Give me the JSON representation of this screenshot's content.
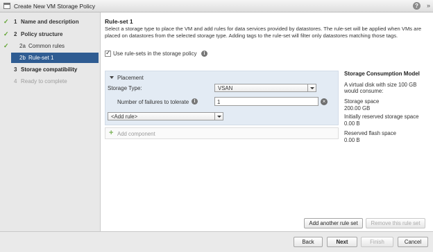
{
  "window": {
    "title": "Create New VM Storage Policy",
    "help_glyph": "?",
    "expand_glyph": "»"
  },
  "sidebar": {
    "steps": [
      {
        "num": "1",
        "label": "Name and description",
        "state": "done"
      },
      {
        "num": "2",
        "label": "Policy structure",
        "state": "done"
      },
      {
        "num": "2a",
        "label": "Common rules",
        "state": "done"
      },
      {
        "num": "2b",
        "label": "Rule-set 1",
        "state": "active"
      },
      {
        "num": "3",
        "label": "Storage compatibility",
        "state": "pending"
      },
      {
        "num": "4",
        "label": "Ready to complete",
        "state": "disabled"
      }
    ]
  },
  "main": {
    "heading": "Rule-set 1",
    "description": "Select a storage type to place the VM and add rules for data services provided by datastores. The rule-set will be applied when VMs are placed on datastores from the selected storage type. Adding tags to the rule-set will filter only datastores matching those tags.",
    "use_rulesets_label": "Use rule-sets in the storage policy",
    "use_rulesets_checked": true,
    "placement": {
      "section_label": "Placement",
      "storage_type_label": "Storage Type:",
      "storage_type_value": "VSAN",
      "ftt_label": "Number of failures to tolerate",
      "ftt_value": "1",
      "add_rule_value": "<Add rule>"
    },
    "add_component_label": "Add component",
    "consumption": {
      "title": "Storage Consumption Model",
      "intro_line1": "A virtual disk with size 100 GB",
      "intro_line2": "would consume:",
      "storage_space_label": "Storage space",
      "storage_space_value": "200.00 GB",
      "reserved_label": "Initially reserved storage space",
      "reserved_value": "0.00 B",
      "flash_label": "Reserved flash space",
      "flash_value": "0.00 B"
    },
    "add_ruleset_button": "Add another rule set",
    "remove_ruleset_button": "Remove this rule set"
  },
  "footer": {
    "back": "Back",
    "next": "Next",
    "finish": "Finish",
    "cancel": "Cancel"
  },
  "colors": {
    "active_step": "#2f5c92",
    "check": "#5fa330",
    "panel_bg": "#e3ebf4"
  },
  "icons": [
    "window-icon",
    "help-icon",
    "expand-icon",
    "check-icon",
    "info-icon",
    "collapse-triangle-icon",
    "dropdown-arrow-icon",
    "clear-icon",
    "plus-icon"
  ]
}
